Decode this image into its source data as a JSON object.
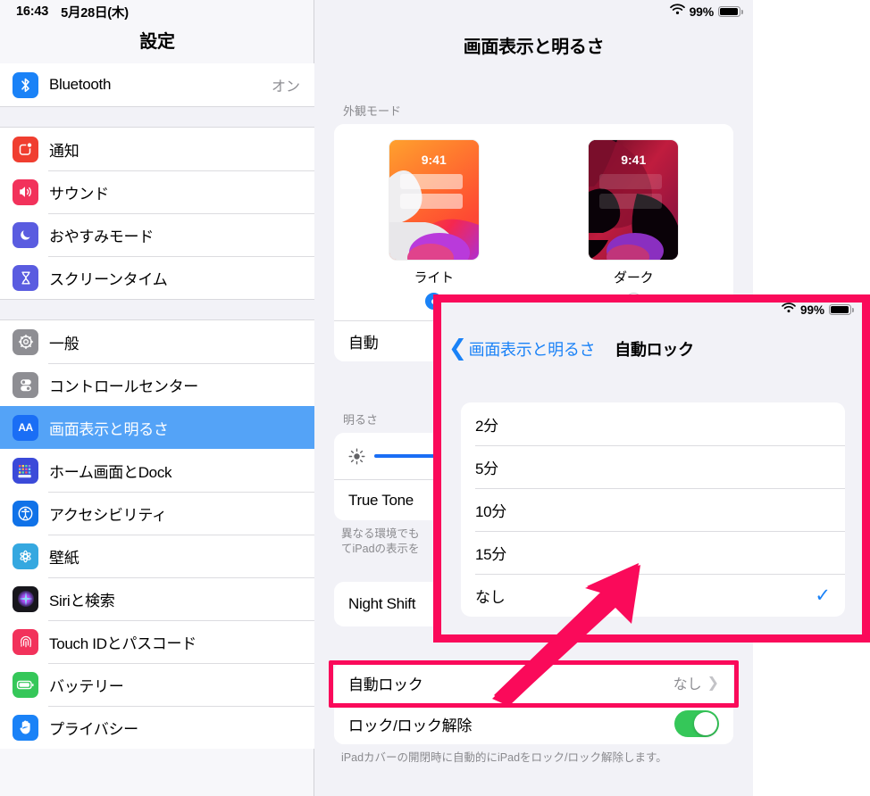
{
  "status_bar": {
    "time": "16:43",
    "date": "5月28日(木)",
    "battery_percent": "99%",
    "wifi_icon": "wifi-icon",
    "battery_icon": "battery-icon"
  },
  "sidebar": {
    "title": "設定",
    "groups": [
      {
        "items": [
          {
            "label": "Bluetooth",
            "value": "オン",
            "icon": "bluetooth-icon",
            "icon_class": "ic-bt",
            "selected": false
          }
        ]
      },
      {
        "items": [
          {
            "label": "通知",
            "value": "",
            "icon": "notifications-icon",
            "icon_class": "ic-notif",
            "selected": false
          },
          {
            "label": "サウンド",
            "value": "",
            "icon": "sound-icon",
            "icon_class": "ic-sound",
            "selected": false
          },
          {
            "label": "おやすみモード",
            "value": "",
            "icon": "moon-icon",
            "icon_class": "ic-dnd",
            "selected": false
          },
          {
            "label": "スクリーンタイム",
            "value": "",
            "icon": "hourglass-icon",
            "icon_class": "ic-screentime",
            "selected": false
          }
        ]
      },
      {
        "items": [
          {
            "label": "一般",
            "value": "",
            "icon": "gear-icon",
            "icon_class": "ic-general",
            "selected": false
          },
          {
            "label": "コントロールセンター",
            "value": "",
            "icon": "sliders-icon",
            "icon_class": "ic-cc",
            "selected": false
          },
          {
            "label": "画面表示と明るさ",
            "value": "",
            "icon": "aa-icon",
            "icon_class": "ic-display",
            "selected": true
          },
          {
            "label": "ホーム画面とDock",
            "value": "",
            "icon": "home-screen-icon",
            "icon_class": "ic-home",
            "selected": false
          },
          {
            "label": "アクセシビリティ",
            "value": "",
            "icon": "accessibility-icon",
            "icon_class": "ic-access",
            "selected": false
          },
          {
            "label": "壁紙",
            "value": "",
            "icon": "wallpaper-icon",
            "icon_class": "ic-wall",
            "selected": false
          },
          {
            "label": "Siriと検索",
            "value": "",
            "icon": "siri-icon",
            "icon_class": "ic-siri",
            "selected": false
          },
          {
            "label": "Touch IDとパスコード",
            "value": "",
            "icon": "fingerprint-icon",
            "icon_class": "ic-touchid",
            "selected": false
          },
          {
            "label": "バッテリー",
            "value": "",
            "icon": "battery-icon",
            "icon_class": "ic-battery",
            "selected": false
          },
          {
            "label": "プライバシー",
            "value": "",
            "icon": "hand-icon",
            "icon_class": "ic-privacy",
            "selected": false
          }
        ]
      }
    ]
  },
  "main": {
    "title": "画面表示と明るさ",
    "appearance": {
      "section_header": "外観モード",
      "options": [
        {
          "label": "ライト",
          "time": "9:41",
          "selected": true
        },
        {
          "label": "ダーク",
          "time": "9:41",
          "selected": false
        }
      ],
      "auto_row_label": "自動"
    },
    "brightness": {
      "section_header": "明るさ",
      "slider_icon": "brightness-sun-icon",
      "slider_percent": "75",
      "true_tone_label": "True Tone",
      "footnote_line1": "異なる環境でも",
      "footnote_line2": "てiPadの表示を"
    },
    "night_shift": {
      "label": "Night Shift"
    },
    "lock_group": {
      "auto_lock_label": "自動ロック",
      "auto_lock_value": "なし",
      "chevron_icon": "chevron-right-icon",
      "cover_lock_label": "ロック/ロック解除",
      "cover_lock_on": true,
      "footnote": "iPadカバーの開閉時に自動的にiPadをロック/ロック解除します。"
    }
  },
  "overlay": {
    "battery_percent": "99%",
    "back_label": "画面表示と明るさ",
    "back_icon": "chevron-left-icon",
    "title": "自動ロック",
    "options": [
      {
        "label": "2分",
        "selected": false
      },
      {
        "label": "5分",
        "selected": false
      },
      {
        "label": "10分",
        "selected": false
      },
      {
        "label": "15分",
        "selected": false
      },
      {
        "label": "なし",
        "selected": true
      }
    ],
    "check_icon": "checkmark-icon"
  },
  "annotations": {
    "highlight_color": "#fa0a5a",
    "arrow_icon": "arrow-up-right-icon"
  }
}
